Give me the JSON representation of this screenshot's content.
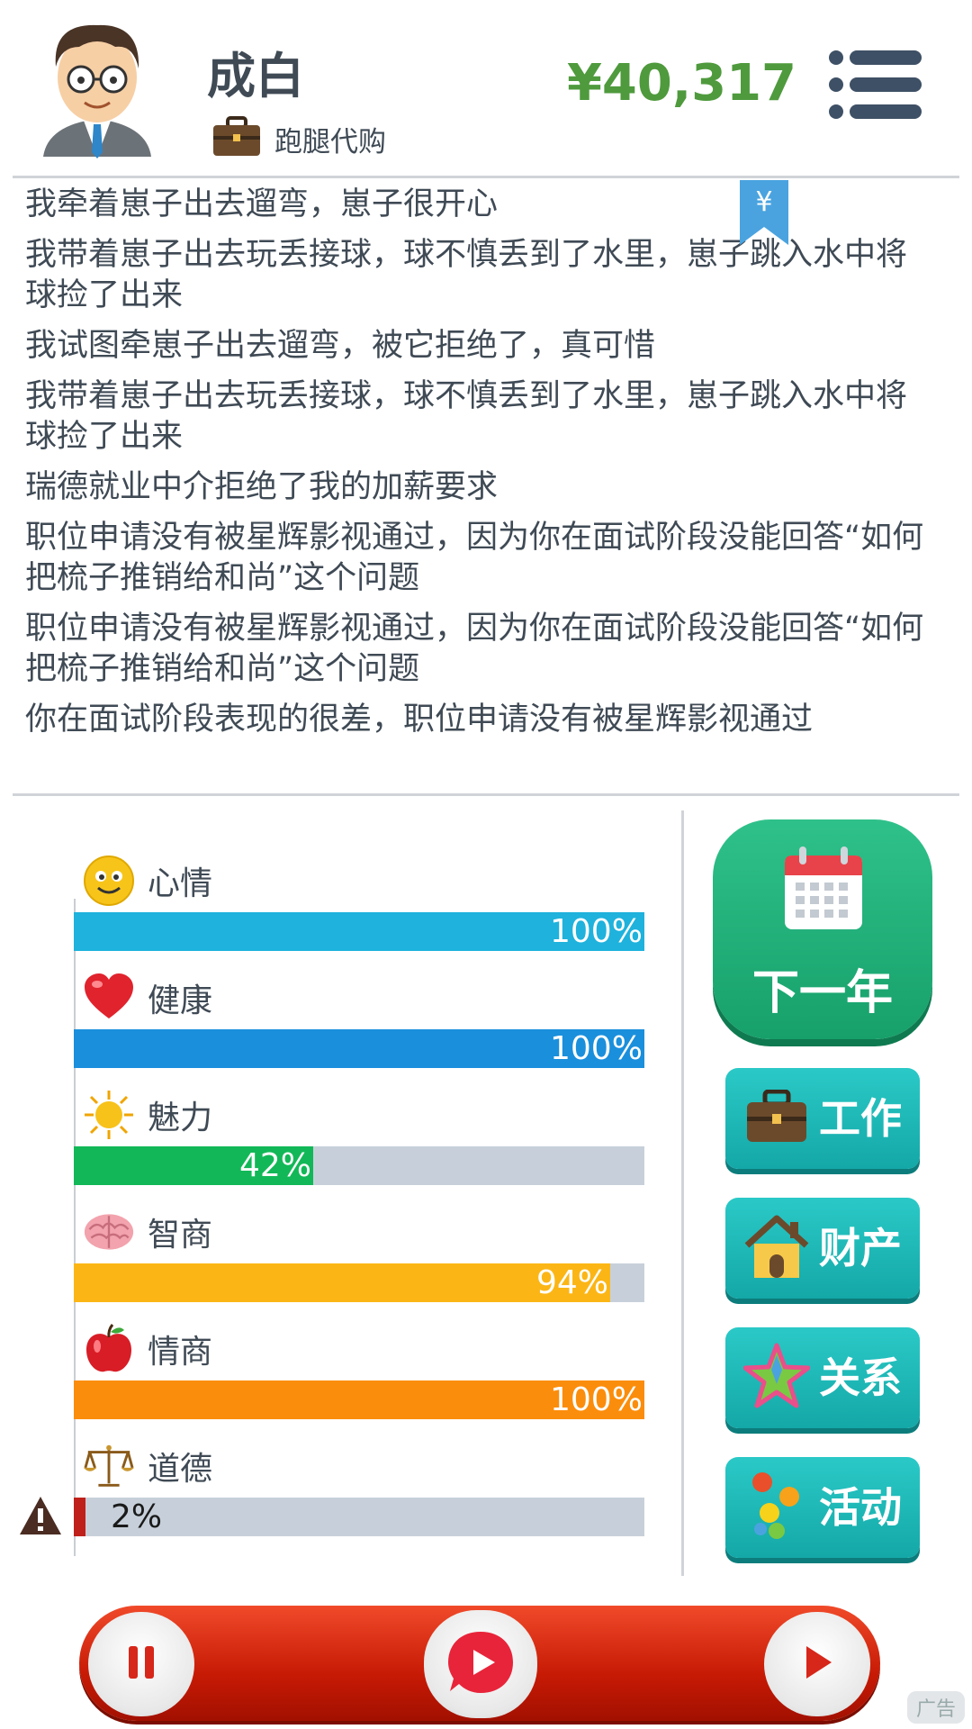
{
  "header": {
    "name": "成白",
    "job": "跑腿代购",
    "money": "¥40,317",
    "bookmark_symbol": "¥"
  },
  "log": [
    "我牵着崽子出去遛弯，崽子很开心",
    "我带着崽子出去玩丢接球，球不慎丢到了水里，崽子跳入水中将球捡了出来",
    "我试图牵崽子出去遛弯，被它拒绝了，真可惜",
    "我带着崽子出去玩丢接球，球不慎丢到了水里，崽子跳入水中将球捡了出来",
    "瑞德就业中介拒绝了我的加薪要求",
    "职位申请没有被星辉影视通过，因为你在面试阶段没能回答“如何把梳子推销给和尚”这个问题",
    "职位申请没有被星辉影视通过，因为你在面试阶段没能回答“如何把梳子推销给和尚”这个问题",
    "你在面试阶段表现的很差，职位申请没有被星辉影视通过"
  ],
  "stats": [
    {
      "label": "心情",
      "pct_text": "100%",
      "value": 100,
      "color": "#1eb2dc",
      "icon": "smiley-face-icon"
    },
    {
      "label": "健康",
      "pct_text": "100%",
      "value": 100,
      "color": "#1a8fdc",
      "icon": "heart-icon"
    },
    {
      "label": "魅力",
      "pct_text": "42%",
      "value": 42,
      "color": "#12b857",
      "icon": "sun-icon"
    },
    {
      "label": "智商",
      "pct_text": "94%",
      "value": 94,
      "color": "#fbb616",
      "icon": "brain-icon"
    },
    {
      "label": "情商",
      "pct_text": "100%",
      "value": 100,
      "color": "#fb8d0c",
      "icon": "apple-icon"
    },
    {
      "label": "道德",
      "pct_text": "2%",
      "value": 2,
      "color": "#c0201a",
      "icon": "scales-icon"
    }
  ],
  "buttons": {
    "next_year": "下一年",
    "work": "工作",
    "property": "财产",
    "relations": "关系",
    "activity": "活动"
  },
  "ad_label": "广告"
}
